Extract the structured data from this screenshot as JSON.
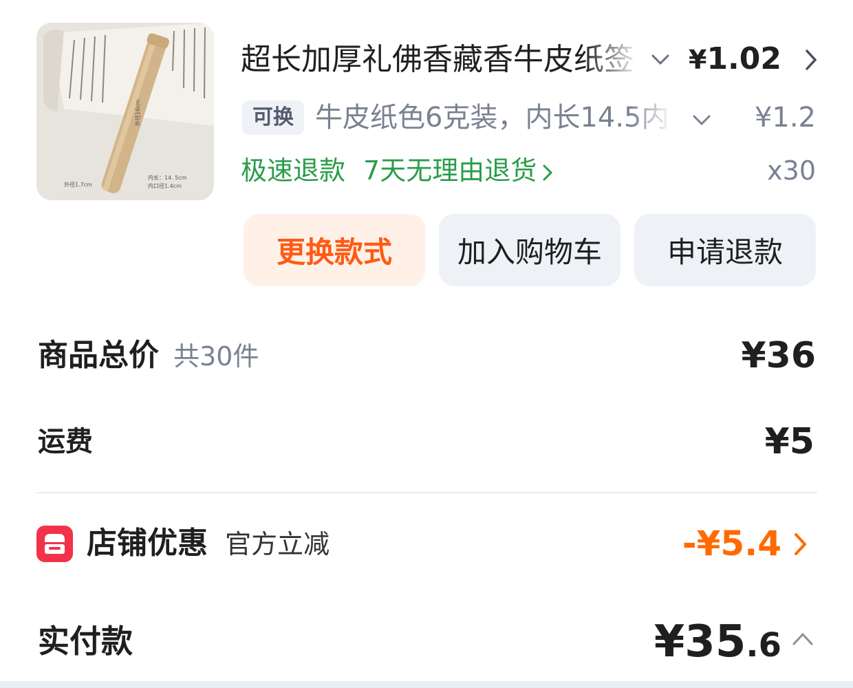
{
  "product": {
    "title": "超长加厚礼佛香藏香牛皮纸签",
    "price_yen": "¥",
    "price_value": "1.02",
    "swap_tag": "可换",
    "spec": "牛皮纸色6克装，内长14.5内",
    "spec_price": "¥1.2",
    "refund_fast": "极速退款",
    "refund_7day": "7天无理由退货",
    "quantity": "x30",
    "image_labels": {
      "height": "外径16cm",
      "inner_len": "内长：14. 5cm",
      "inner_dia": "内口径1.4cm",
      "outer_dia": "外径1.7cm"
    }
  },
  "buttons": {
    "swap": "更换款式",
    "cart": "加入购物车",
    "refund": "申请退款"
  },
  "summary": {
    "total_label": "商品总价",
    "total_count": "共30件",
    "total_value": "¥36",
    "shipping_label": "运费",
    "shipping_value": "¥5",
    "store_discount_label": "店铺优惠",
    "store_discount_sub": "官方立减",
    "store_discount_value": "-¥5.4",
    "paid_label": "实付款",
    "paid_yen": "¥",
    "paid_int": "35",
    "paid_dec": ".6"
  },
  "colors": {
    "accent_orange": "#ff6a00",
    "refund_green": "#2a9d4a",
    "store_icon_red": "#f2324a"
  },
  "icons": [
    "chevron-down-icon",
    "chevron-right-icon",
    "store-icon",
    "chevron-up-icon"
  ]
}
